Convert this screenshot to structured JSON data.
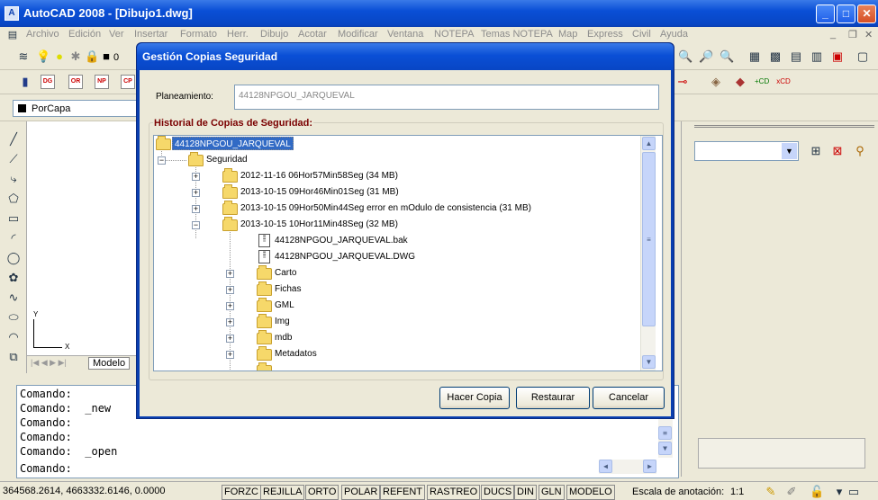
{
  "window": {
    "title": "AutoCAD 2008 - [Dibujo1.dwg]",
    "app_icon": "autocad-icon"
  },
  "menu": [
    "Archivo",
    "Edición",
    "Ver",
    "Insertar",
    "Formato",
    "Herr.",
    "Dibujo",
    "Acotar",
    "Modificar",
    "Ventana",
    "NOTEPA",
    "Temas NOTEPA",
    "Map",
    "Express",
    "Civil",
    "Ayuda"
  ],
  "toolbar": {
    "layer_value": "0",
    "color_value": "PorCapa",
    "tools": [
      "DG",
      "OR",
      "NP",
      "CP"
    ]
  },
  "drawing": {
    "model_tab": "Modelo",
    "axis_y": "Y",
    "axis_x": "X"
  },
  "command_lines": [
    "Comando:",
    "Comando:  _new",
    "Comando:",
    "Comando:",
    "Comando:  _open",
    "Comando:"
  ],
  "status": {
    "coords": "364568.2614, 4663332.6146, 0.0000",
    "buttons": [
      "FORZC",
      "REJILLA",
      "ORTO",
      "POLAR",
      "REFENT",
      "RASTREO",
      "DUCS",
      "DIN",
      "GLN",
      "MODELO"
    ],
    "scale_label": "Escala de anotación:",
    "scale_value": "1:1"
  },
  "dialog": {
    "title": "Gestión Copias Seguridad",
    "planeamiento_label": "Planeamiento:",
    "planeamiento_value": "44128NPGOU_JARQUEVAL",
    "history_label": "Historial de Copias de Seguridad:",
    "tree": [
      {
        "label": "44128NPGOU_JARQUEVAL",
        "level": 0,
        "type": "folder",
        "selected": true
      },
      {
        "label": "Seguridad",
        "level": 1,
        "type": "folder",
        "expander": "-"
      },
      {
        "label": "2012-11-16 06Hor57Min58Seg (34 MB)",
        "level": 2,
        "type": "folder",
        "expander": "+"
      },
      {
        "label": "2013-10-15 09Hor46Min01Seg (31 MB)",
        "level": 2,
        "type": "folder",
        "expander": "+"
      },
      {
        "label": "2013-10-15 09Hor50Min44Seg error en mOdulo de consistencia (31 MB)",
        "level": 2,
        "type": "folder",
        "expander": "+"
      },
      {
        "label": "2013-10-15 10Hor11Min48Seg (32 MB)",
        "level": 2,
        "type": "folder",
        "expander": "-"
      },
      {
        "label": "44128NPGOU_JARQUEVAL.bak",
        "level": 3,
        "type": "file"
      },
      {
        "label": "44128NPGOU_JARQUEVAL.DWG",
        "level": 3,
        "type": "file"
      },
      {
        "label": "Carto",
        "level": 3,
        "type": "folder",
        "expander": "+"
      },
      {
        "label": "Fichas",
        "level": 3,
        "type": "folder",
        "expander": "+"
      },
      {
        "label": "GML",
        "level": 3,
        "type": "folder",
        "expander": "+"
      },
      {
        "label": "Img",
        "level": 3,
        "type": "folder",
        "expander": "+"
      },
      {
        "label": "mdb",
        "level": 3,
        "type": "folder",
        "expander": "+"
      },
      {
        "label": "Metadatos",
        "level": 3,
        "type": "folder",
        "expander": "+"
      }
    ],
    "buttons": {
      "copy": "Hacer Copia",
      "restore": "Restaurar",
      "cancel": "Cancelar"
    }
  },
  "colors": {
    "titlebar": "#0a4fd6",
    "selection": "#316ac5",
    "history_label": "#7a0000"
  }
}
